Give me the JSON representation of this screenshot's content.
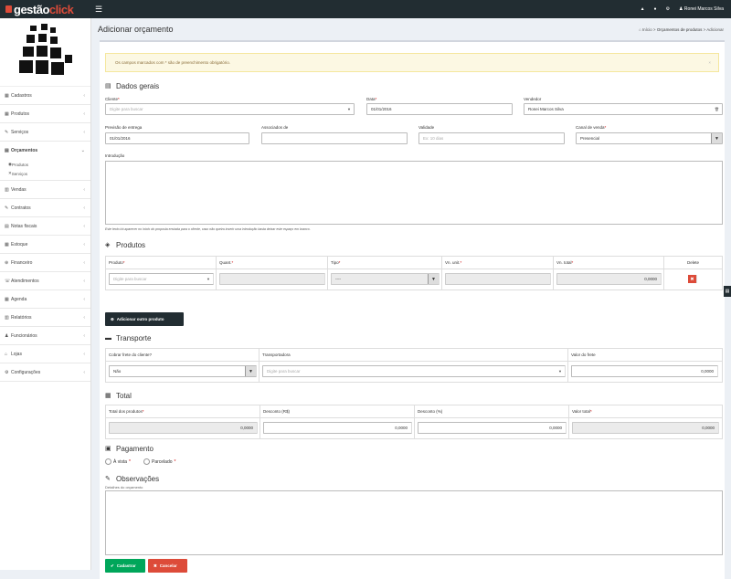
{
  "topbar": {
    "logo_part1": "gestão",
    "logo_part2": "click",
    "user": "Ronei Marcos Silva"
  },
  "nav": [
    {
      "label": "Cadastros"
    },
    {
      "label": "Produtos"
    },
    {
      "label": "Serviços"
    },
    {
      "label": "Orçamentos",
      "open": true,
      "sub": [
        "Produtos",
        "Serviços"
      ]
    },
    {
      "label": "Vendas"
    },
    {
      "label": "Contratos"
    },
    {
      "label": "Notas fiscais"
    },
    {
      "label": "Estoque"
    },
    {
      "label": "Financeiro"
    },
    {
      "label": "Atendimentos"
    },
    {
      "label": "Agenda"
    },
    {
      "label": "Relatórios"
    },
    {
      "label": "Funcionários"
    },
    {
      "label": "Lojas"
    },
    {
      "label": "Configurações"
    }
  ],
  "header": {
    "title": "Adicionar orçamento",
    "crumb_home": "Início",
    "crumb_mid": "Orçamentos de produtos",
    "crumb_last": "Adicionar"
  },
  "alert": "Os campos marcados com * são de preenchimento obrigatório.",
  "dados": {
    "title": "Dados gerais",
    "cliente_label": "Cliente",
    "cliente_ph": "Digite para buscar",
    "data_label": "Data",
    "data_value": "01/01/2016",
    "vendedor_label": "Vendedor",
    "vendedor_value": "Ronei Marcos Silva",
    "previsao_label": "Previsão de entrega",
    "previsao_value": "01/01/2016",
    "associados_label": "Associados de",
    "validade_label": "Validade",
    "validade_ph": "Ex: 10 dias",
    "canal_label": "Canal de venda",
    "canal_value": "Presencial",
    "intro_label": "Introdução",
    "intro_help": "Este texto irá aparecer no início do proposta enviada para o cliente, caso não queira inserir uma introdução basta deixar este espaço em branco."
  },
  "produtos": {
    "title": "Produtos",
    "headers": [
      "Produto",
      "Quant.",
      "Tipo",
      "Vn. unit.",
      "Vn. total",
      "Delete"
    ],
    "produto_ph": "Digite para buscar",
    "tipo_value": "----",
    "total_value": "0,0000",
    "add_button": "Adicionar outro produto"
  },
  "transporte": {
    "title": "Transporte",
    "headers": [
      "Cobrar frete do cliente?",
      "Transportadora",
      "Valor do frete"
    ],
    "cobrar_value": "Não",
    "transp_ph": "Digite para buscar",
    "frete_value": "0,0000"
  },
  "total": {
    "title": "Total",
    "headers": [
      "Total dos produtos",
      "Desconto (R$)",
      "Desconto (%)",
      "Valor total"
    ],
    "values": [
      "0,0000",
      "0,0000",
      "0,0000",
      "0,0000"
    ]
  },
  "pagamento": {
    "title": "Pagamento",
    "opt1": "À vista",
    "opt2": "Parcelado"
  },
  "observacoes": {
    "title": "Observações",
    "sublabel": "Detalhes do orçamento"
  },
  "actions": {
    "save": "Cadastrar",
    "cancel": "Cancelar"
  },
  "colors": {
    "topbar": "#222d32",
    "accent": "#dd4b39",
    "save": "#00a65a",
    "cancel": "#dd4b39"
  }
}
